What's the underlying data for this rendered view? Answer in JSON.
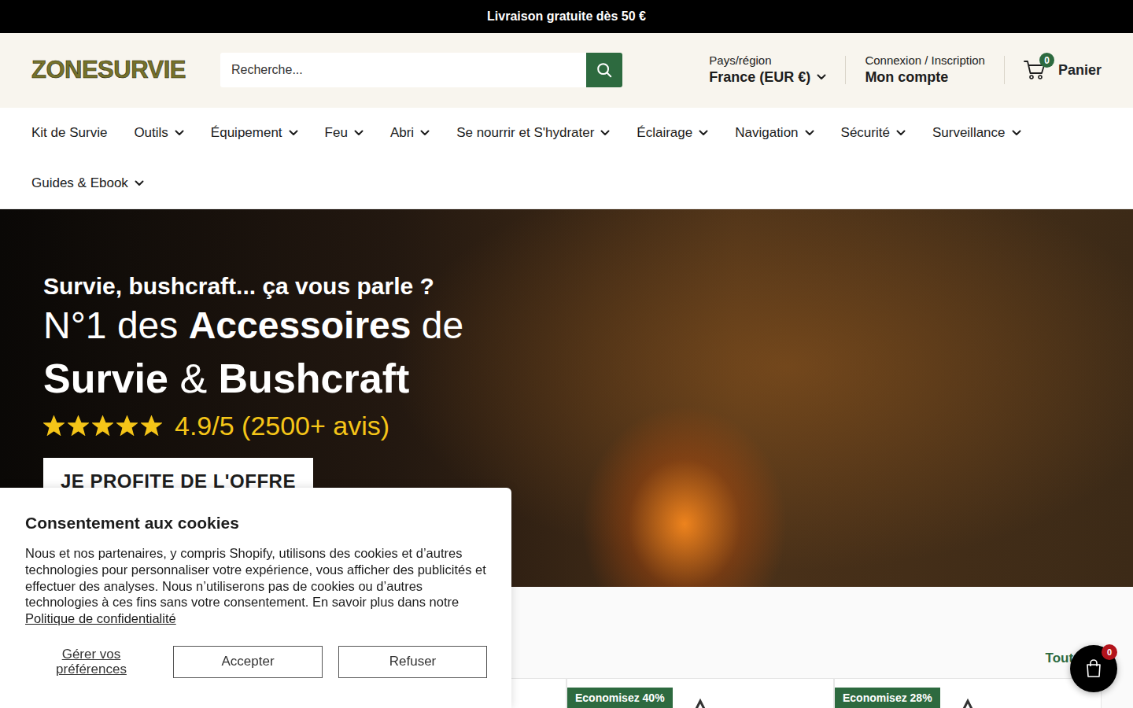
{
  "announcement": "Livraison gratuite dès 50 €",
  "header": {
    "logo": "ZONESURVIE",
    "search": {
      "placeholder": "Recherche..."
    },
    "country": {
      "label": "Pays/région",
      "value": "France (EUR €)"
    },
    "account": {
      "label": "Connexion / Inscription",
      "value": "Mon compte"
    },
    "cart": {
      "count": "0",
      "label": "Panier"
    }
  },
  "nav": [
    {
      "label": "Kit de Survie",
      "dropdown": false
    },
    {
      "label": "Outils",
      "dropdown": true
    },
    {
      "label": "Équipement",
      "dropdown": true
    },
    {
      "label": "Feu",
      "dropdown": true
    },
    {
      "label": "Abri",
      "dropdown": true
    },
    {
      "label": "Se nourrir et S'hydrater",
      "dropdown": true
    },
    {
      "label": "Éclairage",
      "dropdown": true
    },
    {
      "label": "Navigation",
      "dropdown": true
    },
    {
      "label": "Sécurité",
      "dropdown": true
    },
    {
      "label": "Surveillance",
      "dropdown": true
    },
    {
      "label": "Guides & Ebook",
      "dropdown": true
    }
  ],
  "hero": {
    "kicker": "Survie, bushcraft... ça vous parle ?",
    "lines": [
      [
        {
          "text": "N°1 des ",
          "bold": false
        },
        {
          "text": "Accessoires",
          "bold": true
        },
        {
          "text": " de",
          "bold": false
        }
      ],
      [
        {
          "text": "Survie",
          "bold": true
        },
        {
          "text": " & ",
          "bold": false
        },
        {
          "text": "Bushcraft",
          "bold": true
        }
      ]
    ],
    "rating": {
      "stars": 5,
      "text": "4.9/5 (2500+ avis)"
    },
    "cta": "JE PROFITE DE L'OFFRE"
  },
  "products": {
    "link": "Tout voir",
    "items": [
      {},
      {},
      {
        "badge": "Economisez 40%"
      },
      {
        "badge": "Economisez 28%"
      }
    ]
  },
  "cookie": {
    "title": "Consentement aux cookies",
    "text": "Nous et nos partenaires, y compris Shopify, utilisons des cookies et d’autres technologies pour personnaliser votre expérience, vous afficher des publicités et effectuer des analyses. Nous n’utiliserons pas de cookies ou d’autres technologies à ces fins sans votre consentement. En savoir plus dans notre ",
    "link": "Politique de confidentialité",
    "buttons": [
      {
        "label": "Gérer vos préférences",
        "kind": "link"
      },
      {
        "label": "Accepter",
        "kind": "outline"
      },
      {
        "label": "Refuser",
        "kind": "outline"
      }
    ]
  },
  "floating_cart": {
    "count": "0"
  }
}
